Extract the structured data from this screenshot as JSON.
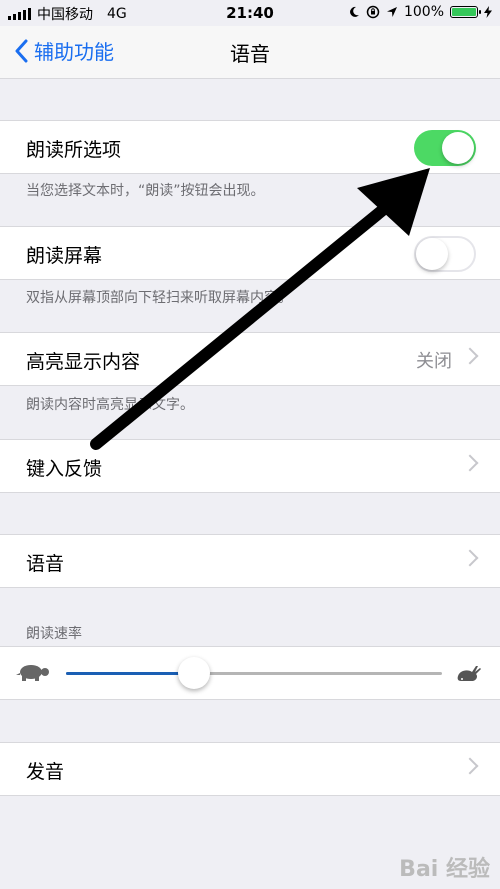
{
  "status_bar": {
    "carrier": "中国移动",
    "network": "4G",
    "time": "21:40",
    "battery_percent": "100%",
    "battery_color": "#34c759"
  },
  "nav": {
    "back_label": "辅助功能",
    "title": "语音",
    "accent_color": "#1a6ef0"
  },
  "speak_selection": {
    "label": "朗读所选项",
    "enabled": true,
    "footer": "当您选择文本时，“朗读”按钮会出现。"
  },
  "speak_screen": {
    "label": "朗读屏幕",
    "enabled": false,
    "footer": "双指从屏幕顶部向下轻扫来听取屏幕内容。"
  },
  "highlight_content": {
    "label": "高亮显示内容",
    "value": "关闭",
    "footer": "朗读内容时高亮显示文字。"
  },
  "typing_feedback": {
    "label": "键入反馈"
  },
  "voices": {
    "label": "语音"
  },
  "speaking_rate": {
    "header": "朗读速率",
    "value": 0.34,
    "slow_icon": "turtle-icon",
    "fast_icon": "rabbit-icon"
  },
  "pronunciations": {
    "label": "发音"
  },
  "watermark": "Bai 经验"
}
